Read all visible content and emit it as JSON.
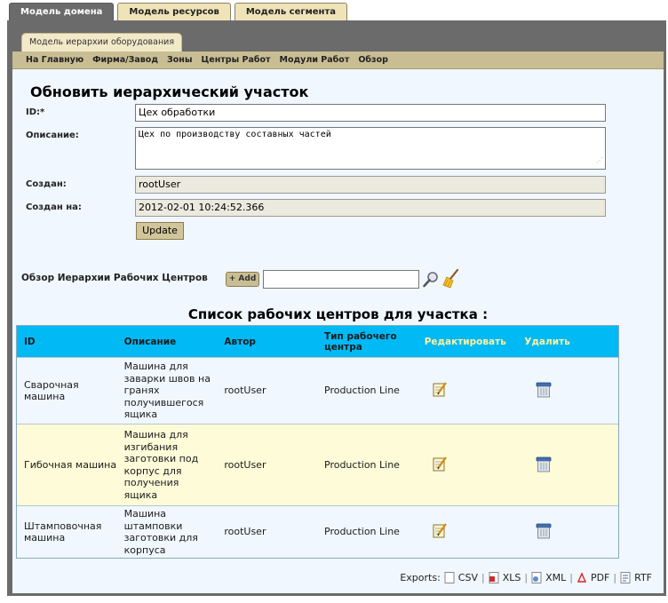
{
  "top_tabs": [
    {
      "label": "Модель домена",
      "active": true
    },
    {
      "label": "Модель ресурсов",
      "active": false
    },
    {
      "label": "Модель сегмента",
      "active": false
    }
  ],
  "sub_tab": "Модель иерархии оборудования",
  "nav": [
    "На Главную",
    "Фирма/Завод",
    "Зоны",
    "Центры Работ",
    "Модули Работ",
    "Обзор"
  ],
  "form": {
    "title": "Обновить иерархический участок",
    "id_label": "ID:*",
    "id_value": "Цех обработки",
    "desc_label": "Описание:",
    "desc_value": "Цех по производству составных частей",
    "created_by_label": "Создан:",
    "created_by_value": "rootUser",
    "created_on_label": "Создан на:",
    "created_on_value": "2012-02-01 10:24:52.366",
    "update_label": "Update"
  },
  "hierarchy": {
    "label": "Обзор Иерархии Рабочих Центров",
    "add_label": "+ Add",
    "search_value": ""
  },
  "list": {
    "title": "Список рабочих центров для участка :",
    "columns": [
      "ID",
      "Описание",
      "Автор",
      "Тип рабочего центра",
      "Редактировать",
      "Удалить"
    ],
    "rows": [
      {
        "id": "Сварочная машина",
        "description": "Машина для заварки швов на гранях получившегося ящика",
        "author": "rootUser",
        "type": "Production Line"
      },
      {
        "id": "Гибочная машина",
        "description": "Машина для изгибания заготовки под корпус для получения ящика",
        "author": "rootUser",
        "type": "Production Line"
      },
      {
        "id": "Штамповочная машина",
        "description": "Машина штамповки заготовки для корпуса",
        "author": "rootUser",
        "type": "Production Line"
      }
    ]
  },
  "exports": {
    "label": "Exports:",
    "formats": [
      "CSV",
      "XLS",
      "XML",
      "PDF",
      "RTF"
    ]
  },
  "colors": {
    "table_header": "#00b9f5",
    "header_link": "#fff3a0",
    "nav_bar": "#c9bd94",
    "content_bg": "#f0f7fe",
    "alt_row": "#fdfbd8",
    "frame": "#6b6b6b"
  },
  "icons": {
    "search": "magnifier-icon",
    "clear": "broom-icon",
    "edit": "notepad-pencil-icon",
    "delete": "trash-bin-icon"
  }
}
